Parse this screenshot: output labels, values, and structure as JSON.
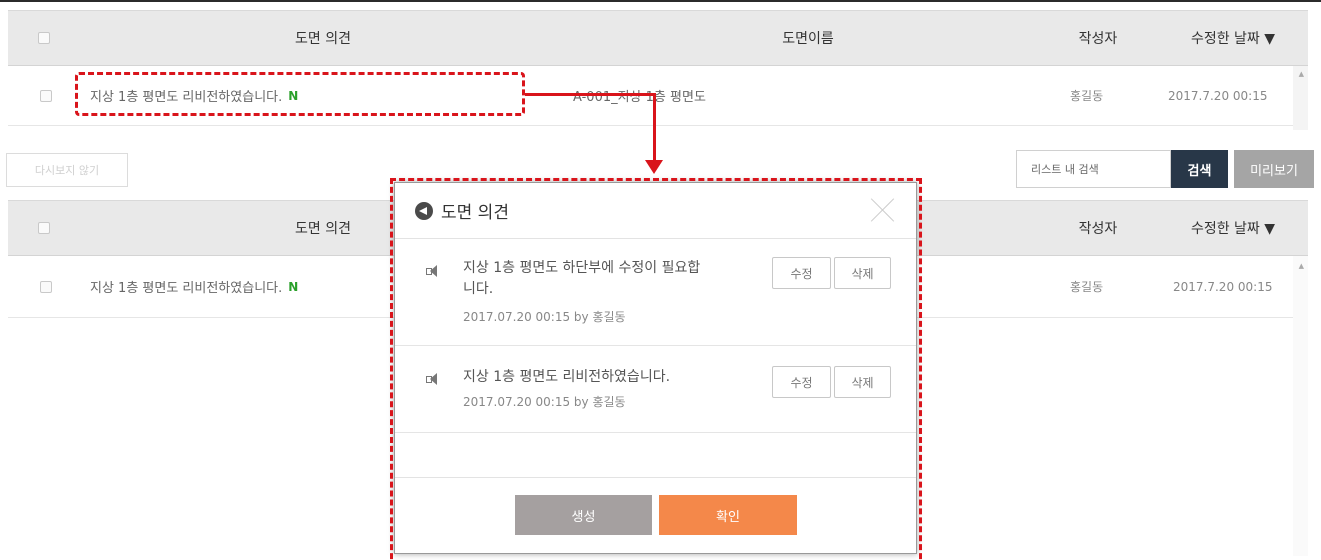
{
  "table_top": {
    "headers": [
      "도면 의견",
      "도면이름",
      "작성자",
      "수정한 날짜 ▼"
    ],
    "row": {
      "comment": "지상 1층 평면도 리비전하였습니다.",
      "new_tag": "N",
      "drawing_name": "A-001_지상 1층 평면도",
      "author": "홍길동",
      "date": "2017.7.20 00:15"
    }
  },
  "toolbar": {
    "ghost_button": "다시보지 않기",
    "search_placeholder": "리스트 내 검색",
    "search_button": "검색",
    "preview_button": "미리보기"
  },
  "table_bottom": {
    "headers": [
      "도면 의견",
      "작성자",
      "수정한 날짜 ▼"
    ],
    "row": {
      "comment": "지상 1층 평면도 리비전하였습니다.",
      "new_tag": "N",
      "author": "홍길동",
      "date": "2017.7.20 00:15"
    }
  },
  "modal": {
    "title": "도면 의견",
    "comments": [
      {
        "text_line1": "지상 1층 평면도 하단부에 수정이 필요합",
        "text_line2": "니다.",
        "meta": "2017.07.20 00:15  by 홍길동",
        "edit": "수정",
        "delete": "삭제"
      },
      {
        "text_line1": "지상 1층 평면도 리비전하였습니다.",
        "meta": "2017.07.20 00:15  by 홍길동",
        "edit": "수정",
        "delete": "삭제"
      }
    ],
    "create_button": "생성",
    "confirm_button": "확인"
  },
  "colors": {
    "annotation_red": "#d9141b",
    "search_button_bg": "#283748",
    "confirm_button_bg": "#f4884a",
    "new_tag_green": "#2aa02a"
  }
}
